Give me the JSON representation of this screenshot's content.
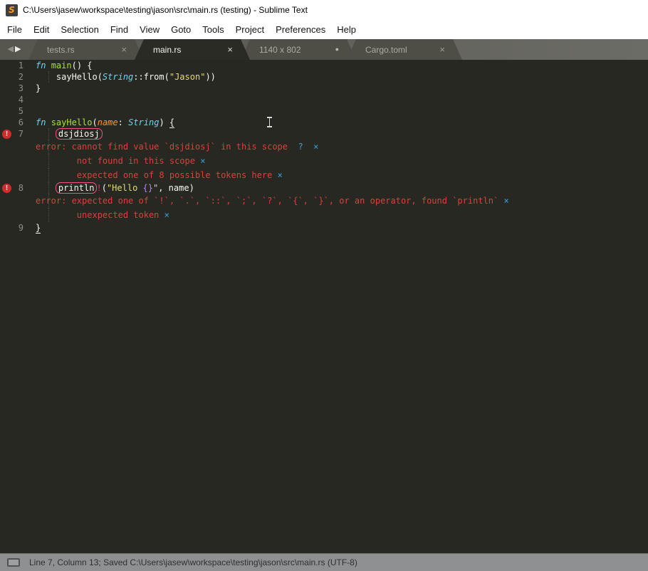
{
  "window": {
    "title": "C:\\Users\\jasew\\workspace\\testing\\jason\\src\\main.rs (testing) - Sublime Text",
    "app_icon_letter": "S"
  },
  "menu": {
    "items": [
      "File",
      "Edit",
      "Selection",
      "Find",
      "View",
      "Goto",
      "Tools",
      "Project",
      "Preferences",
      "Help"
    ]
  },
  "tabs": {
    "nav_back": "◀",
    "nav_forward": "▶",
    "items": [
      {
        "label": "tests.rs",
        "active": false,
        "modified": false,
        "close_glyph": "×"
      },
      {
        "label": "main.rs",
        "active": true,
        "modified": false,
        "close_glyph": "×"
      },
      {
        "label": "1140 x 802",
        "active": false,
        "modified": true,
        "close_glyph": "●"
      },
      {
        "label": "Cargo.toml",
        "active": false,
        "modified": false,
        "close_glyph": "×"
      }
    ]
  },
  "editor": {
    "rows": [
      {
        "type": "code",
        "num": "1",
        "tokens": [
          [
            "fn",
            "kw"
          ],
          [
            " ",
            "p"
          ],
          [
            "main",
            "fn"
          ],
          [
            "() {",
            "p"
          ]
        ]
      },
      {
        "type": "code",
        "num": "2",
        "guide": true,
        "tokens": [
          [
            "    sayHello(",
            "p"
          ],
          [
            "String",
            "type"
          ],
          [
            "::from(",
            "p"
          ],
          [
            "\"Jason\"",
            "str"
          ],
          [
            "))",
            "p"
          ]
        ]
      },
      {
        "type": "code",
        "num": "3",
        "tokens": [
          [
            "}",
            "p"
          ]
        ]
      },
      {
        "type": "code",
        "num": "4",
        "tokens": []
      },
      {
        "type": "code",
        "num": "5",
        "tokens": []
      },
      {
        "type": "code",
        "num": "6",
        "tokens": [
          [
            "fn",
            "kw"
          ],
          [
            " ",
            "p"
          ],
          [
            "sayHello",
            "fn"
          ],
          [
            "(",
            "p"
          ],
          [
            "name",
            "param"
          ],
          [
            ": ",
            "p"
          ],
          [
            "String",
            "type"
          ],
          [
            ") ",
            "p"
          ],
          [
            "{",
            "p u"
          ]
        ]
      },
      {
        "type": "code",
        "num": "7",
        "error": true,
        "guide": true,
        "tokens": [
          [
            "    ",
            "p"
          ],
          [
            "dsjdiosj",
            "box"
          ]
        ]
      },
      {
        "type": "ann",
        "guide": true,
        "tokens": [
          [
            "error: cannot find value `dsjdiosj` in this scope",
            "red"
          ],
          [
            "  ",
            "p"
          ],
          [
            "?",
            "blue"
          ],
          [
            "  ",
            "p"
          ],
          [
            "×",
            "blue"
          ]
        ]
      },
      {
        "type": "ann",
        "guide": true,
        "tokens": [
          [
            "        not found in this scope ",
            "red"
          ],
          [
            "×",
            "blue"
          ]
        ]
      },
      {
        "type": "ann",
        "guide": true,
        "tokens": [
          [
            "        expected one of 8 possible tokens here ",
            "red"
          ],
          [
            "×",
            "blue"
          ]
        ]
      },
      {
        "type": "code",
        "num": "8",
        "error": true,
        "guide": true,
        "tokens": [
          [
            "    ",
            "p"
          ],
          [
            "println",
            "box"
          ],
          [
            "!",
            "pink"
          ],
          [
            "(",
            "p"
          ],
          [
            "\"Hello ",
            "str"
          ],
          [
            "{}",
            "purple"
          ],
          [
            "\"",
            "str"
          ],
          [
            ", name)",
            "p"
          ]
        ]
      },
      {
        "type": "ann",
        "guide": true,
        "tokens": [
          [
            "error: expected one of `!`, `.`, `::`, `;`, `?`, `{`, `}`, or an operator, found `println` ",
            "red"
          ],
          [
            "×",
            "blue"
          ]
        ]
      },
      {
        "type": "ann",
        "guide": true,
        "tokens": [
          [
            "        unexpected token ",
            "red"
          ],
          [
            "×",
            "blue"
          ]
        ]
      },
      {
        "type": "code",
        "num": "9",
        "tokens": [
          [
            "}",
            "p u"
          ]
        ]
      }
    ]
  },
  "status": {
    "text": "Line 7, Column 13; Saved C:\\Users\\jasew\\workspace\\testing\\jason\\src\\main.rs (UTF-8)"
  },
  "colors": {
    "editor_bg": "#272822",
    "error_red": "#e23d3d",
    "action_blue": "#3aa1d8",
    "highlight_pink": "#f92672",
    "string_yellow": "#e6db74",
    "keyword_cyan": "#66d9ef",
    "function_green": "#a6e22e",
    "param_orange": "#fd971f",
    "gutter_gray": "#8f8f84",
    "tabbar_gray": "#605f58",
    "status_gray": "#8e9092"
  }
}
